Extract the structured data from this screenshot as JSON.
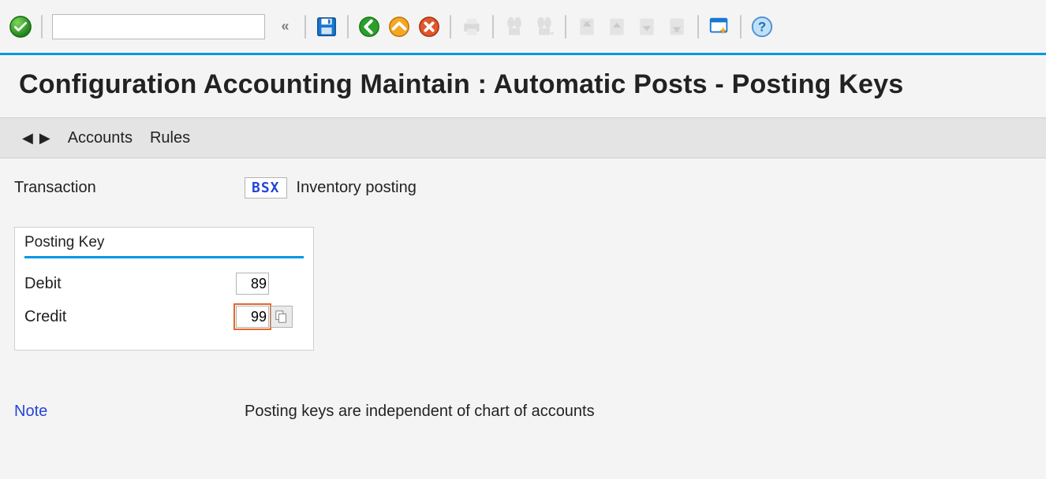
{
  "toolbar": {
    "command_value": "",
    "command_placeholder": ""
  },
  "page": {
    "title": "Configuration Accounting Maintain : Automatic Posts - Posting Keys"
  },
  "subtoolbar": {
    "accounts_label": "Accounts",
    "rules_label": "Rules"
  },
  "transaction": {
    "label": "Transaction",
    "code": "BSX",
    "description": "Inventory posting"
  },
  "posting_key": {
    "group_title": "Posting Key",
    "debit_label": "Debit",
    "debit_value": "89",
    "credit_label": "Credit",
    "credit_value": "99"
  },
  "note": {
    "label": "Note",
    "text": "Posting keys are independent of chart of accounts"
  },
  "icons": {
    "enter": "enter-ok-icon",
    "collapse": "collapse-command-field-icon",
    "save": "save-icon",
    "back": "back-icon",
    "exit": "exit-icon",
    "cancel": "cancel-icon",
    "print": "print-icon",
    "find": "find-icon",
    "find_next": "find-next-icon",
    "first": "first-page-icon",
    "prev": "previous-page-icon",
    "next": "next-page-icon",
    "last": "last-page-icon",
    "new_session": "create-session-icon",
    "help": "help-icon",
    "f4": "search-help-icon"
  }
}
